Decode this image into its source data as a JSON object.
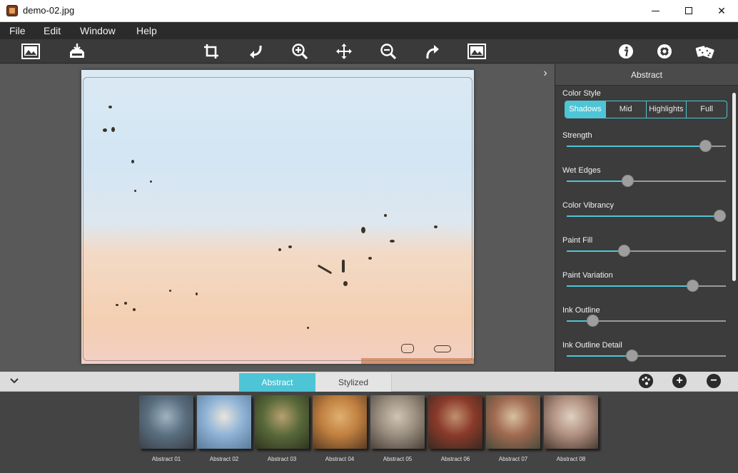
{
  "window": {
    "title": "demo-02.jpg"
  },
  "menu": [
    "File",
    "Edit",
    "Window",
    "Help"
  ],
  "toolbar": {
    "icons": [
      "open-image-icon",
      "save-icon",
      "crop-icon",
      "undo-icon",
      "zoom-in-icon",
      "move-icon",
      "zoom-out-icon",
      "redo-icon",
      "fit-image-icon",
      "info-icon",
      "settings-icon",
      "dice-icon"
    ]
  },
  "panel": {
    "title": "Abstract",
    "color_style": {
      "label": "Color Style",
      "options": [
        "Shadows",
        "Mid",
        "Highlights",
        "Full"
      ],
      "selected": "Shadows"
    },
    "sliders": [
      {
        "label": "Strength",
        "value": 0.87
      },
      {
        "label": "Wet Edges",
        "value": 0.38
      },
      {
        "label": "Color Vibrancy",
        "value": 0.96
      },
      {
        "label": "Paint Fill",
        "value": 0.36
      },
      {
        "label": "Paint Variation",
        "value": 0.79
      },
      {
        "label": "Ink Outline",
        "value": 0.16
      },
      {
        "label": "Ink Outline Detail",
        "value": 0.41
      }
    ]
  },
  "tabs": {
    "abstract": "Abstract",
    "stylized": "Stylized"
  },
  "presets": [
    {
      "label": "Abstract 01",
      "colors": [
        "#5a6f80",
        "#9fb3c0",
        "#3a4048"
      ]
    },
    {
      "label": "Abstract 02",
      "colors": [
        "#8fb3d6",
        "#e8e4dc",
        "#5a7a98"
      ]
    },
    {
      "label": "Abstract 03",
      "colors": [
        "#5a6a3a",
        "#b8a070",
        "#2e3420"
      ]
    },
    {
      "label": "Abstract 04",
      "colors": [
        "#c08040",
        "#e0b070",
        "#5a3a20"
      ]
    },
    {
      "label": "Abstract 05",
      "colors": [
        "#9a8e80",
        "#d0c4b4",
        "#4a4038"
      ]
    },
    {
      "label": "Abstract 06",
      "colors": [
        "#8a3a2a",
        "#c09070",
        "#3a2a20"
      ]
    },
    {
      "label": "Abstract 07",
      "colors": [
        "#a06a50",
        "#d8c0a0",
        "#4a4a3a"
      ]
    },
    {
      "label": "Abstract 08",
      "colors": [
        "#b09080",
        "#e0d0c0",
        "#4a3a30"
      ]
    }
  ],
  "colors": {
    "accent": "#4ec5d6"
  }
}
